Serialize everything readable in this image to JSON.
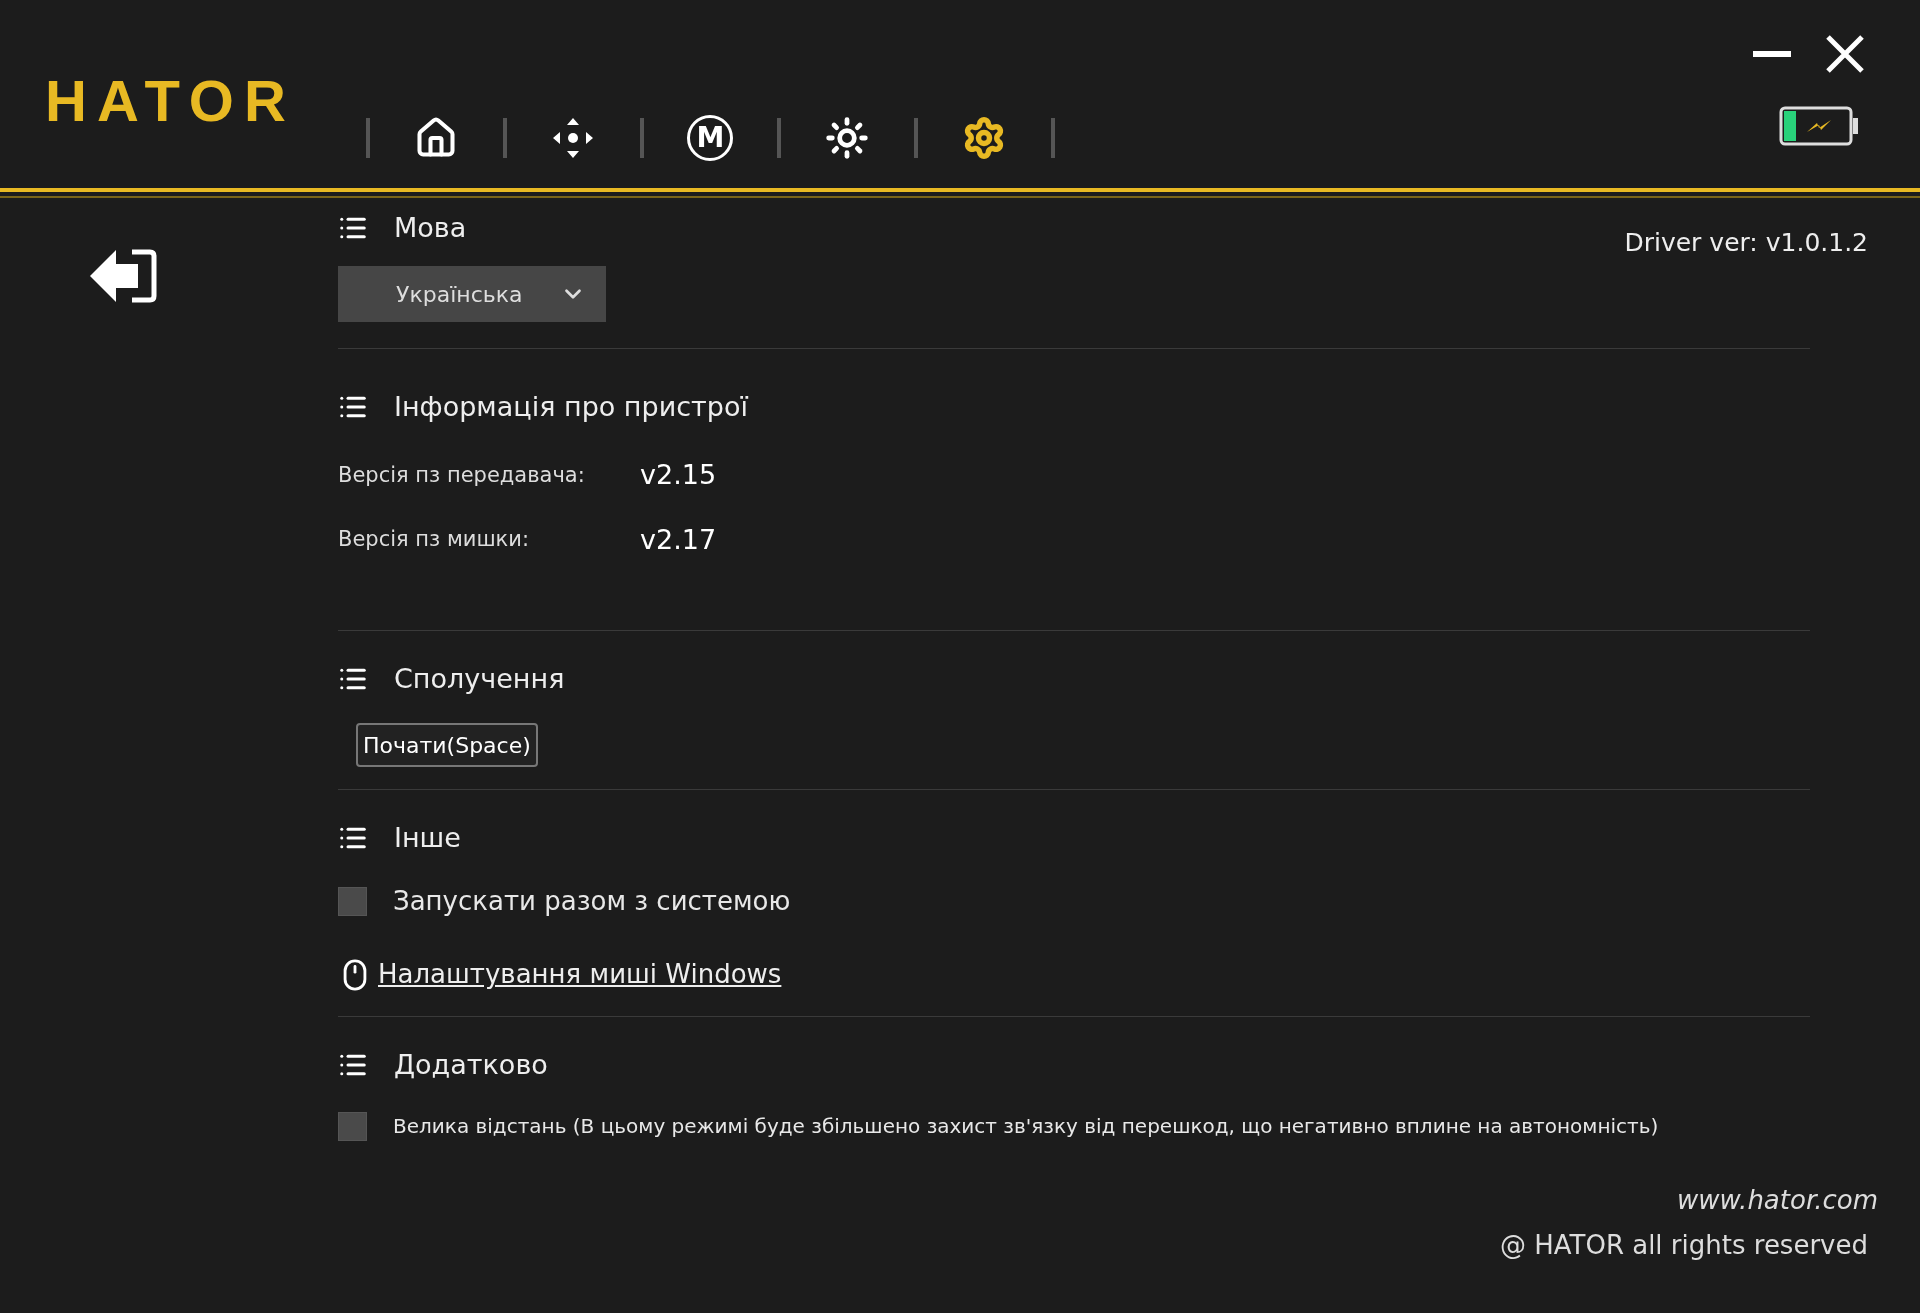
{
  "logo": "HATOR",
  "nav": [
    {
      "kind": "home",
      "selected": false
    },
    {
      "kind": "dpad",
      "selected": false
    },
    {
      "kind": "letter",
      "label": "M",
      "selected": false
    },
    {
      "kind": "light",
      "selected": false
    },
    {
      "kind": "settings",
      "selected": true
    }
  ],
  "driver_version": "Driver ver: v1.0.1.2",
  "sections": [
    {
      "title": "Мова",
      "dropdown": {
        "value": "Українська"
      }
    },
    {
      "title": "Інформація про пристрої",
      "rows": [
        {
          "label": "Версія пз передавача:",
          "value": "v2.15"
        },
        {
          "label": "Версія пз мишки:",
          "value": "v2.17"
        }
      ]
    },
    {
      "title": "Сполучення",
      "button": "Почати(Space)"
    },
    {
      "title": "Інше",
      "checkbox": {
        "label": "Запускати разом з системою",
        "checked": false
      },
      "link": "Налаштування миші Windows"
    },
    {
      "title": "Додатково",
      "checkbox": {
        "label": "Велика відстань (В цьому режимі буде збільшено захист зв'язку від перешкод, що негативно вплине на автономність)",
        "checked": false
      }
    }
  ],
  "footer": {
    "website": "www.hator.com",
    "copyright": "@ HATOR all rights reserved"
  }
}
